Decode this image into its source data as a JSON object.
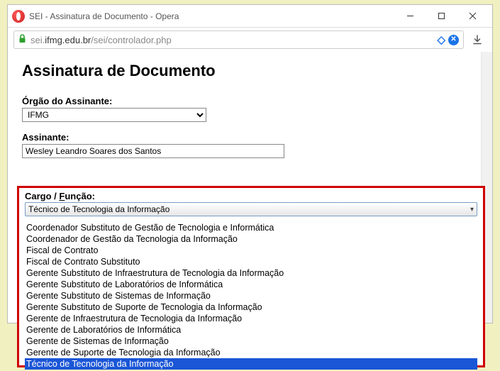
{
  "window": {
    "title": "SEI - Assinatura de Documento - Opera"
  },
  "address": {
    "url_prefix": "sei.",
    "url_domain": "ifmg.edu.br",
    "url_path": "/sei/controlador.php",
    "stop_label": "✕"
  },
  "page": {
    "title": "Assinatura de Documento",
    "orgao_label": "Órgão do Assinante:",
    "orgao_value": "IFMG",
    "assinante_label": "Assinante:",
    "assinante_value": "Wesley Leandro Soares dos Santos"
  },
  "cargo": {
    "label_prefix": "Cargo / ",
    "label_mn": "F",
    "label_suffix": "unção:",
    "selected": "Técnico de Tecnologia da Informação",
    "options": [
      "Coordenador Substituto de Gestão de Tecnologia e Informática",
      "Coordenador de Gestão da Tecnologia da Informação",
      "Fiscal de Contrato",
      "Fiscal de Contrato Substituto",
      "Gerente Substituto de Infraestrutura de Tecnologia da Informação",
      "Gerente Substituto de Laboratórios de Informática",
      "Gerente Substituto de Sistemas de Informação",
      "Gerente Substituto de Suporte de Tecnologia da Informação",
      "Gerente de Infraestrutura de Tecnologia da Informação",
      "Gerente de Laboratórios de Informática",
      "Gerente de Sistemas de Informação",
      "Gerente de Suporte de Tecnologia da Informação",
      "Técnico de Tecnologia da Informação"
    ],
    "selected_index": 12
  }
}
